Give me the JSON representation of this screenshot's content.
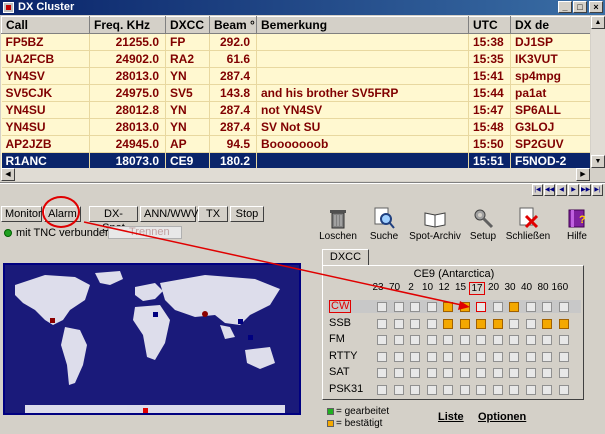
{
  "window": {
    "title": "DX Cluster"
  },
  "table": {
    "headers": [
      "Call",
      "Freq. KHz",
      "DXCC",
      "Beam °",
      "Bemerkung",
      "UTC",
      "DX de"
    ],
    "rows": [
      [
        "FP5BZ",
        "21255.0",
        "FP",
        "292.0",
        "",
        "15:38",
        "DJ1SP"
      ],
      [
        "UA2FCB",
        "24902.0",
        "RA2",
        "61.6",
        "",
        "15:35",
        "IK3VUT"
      ],
      [
        "YN4SV",
        "28013.0",
        "YN",
        "287.4",
        "",
        "15:41",
        "sp4mpg"
      ],
      [
        "SV5CJK",
        "24975.0",
        "SV5",
        "143.8",
        "and his brother SV5FRP",
        "15:44",
        "pa1at"
      ],
      [
        "YN4SU",
        "28012.8",
        "YN",
        "287.4",
        "not YN4SV",
        "15:47",
        "SP6ALL"
      ],
      [
        "YN4SU",
        "28013.0",
        "YN",
        "287.4",
        "SV Not SU",
        "15:48",
        "G3LOJ"
      ],
      [
        "AP2JZB",
        "24945.0",
        "AP",
        "94.5",
        "Booooooob",
        "15:50",
        "SP2GUV"
      ],
      [
        "R1ANC",
        "18073.0",
        "CE9",
        "180.2",
        "",
        "15:51",
        "F5NOD-2"
      ]
    ],
    "selected_row": 7
  },
  "tabs": [
    "Monitor",
    "Alarm",
    "DX-Spot",
    "ANN/WWV",
    "TX",
    "Stop"
  ],
  "status": {
    "tnc_label": "mit TNC verbunden",
    "disconnect_label": "Trennen"
  },
  "toolbar": [
    "Loschen",
    "Suche",
    "Spot-Archiv",
    "Setup",
    "Schließen",
    "Hilfe"
  ],
  "dxcc": {
    "tab_label": "DXCC",
    "entity": "CE9 (Antarctica)",
    "bands": [
      "23",
      "70",
      "2",
      "10",
      "12",
      "15",
      "17",
      "20",
      "30",
      "40",
      "80",
      "160"
    ],
    "highlight_band": "17",
    "modes": [
      {
        "name": "CW",
        "states": [
          "",
          "",
          "",
          "",
          "c",
          "c",
          "",
          "",
          "c",
          "",
          "",
          ""
        ]
      },
      {
        "name": "SSB",
        "states": [
          "",
          "",
          "",
          "",
          "c",
          "c",
          "c",
          "c",
          "",
          "",
          "c",
          "c"
        ]
      },
      {
        "name": "FM",
        "states": [
          "",
          "",
          "",
          "",
          "",
          "",
          "",
          "",
          "",
          "",
          "",
          ""
        ]
      },
      {
        "name": "RTTY",
        "states": [
          "",
          "",
          "",
          "",
          "",
          "",
          "",
          "",
          "",
          "",
          "",
          ""
        ]
      },
      {
        "name": "SAT",
        "states": [
          "",
          "",
          "",
          "",
          "",
          "",
          "",
          "",
          "",
          "",
          "",
          ""
        ]
      },
      {
        "name": "PSK31",
        "states": [
          "",
          "",
          "",
          "",
          "",
          "",
          "",
          "",
          "",
          "",
          "",
          ""
        ]
      }
    ],
    "legend": {
      "worked": "= gearbeitet",
      "confirmed": "= bestätigt"
    },
    "links": {
      "list": "Liste",
      "options": "Optionen"
    }
  },
  "colors": {
    "worked": "#20b020",
    "confirmed": "#f4a800",
    "selection": "#0a246a",
    "annotation": "#e00000"
  }
}
